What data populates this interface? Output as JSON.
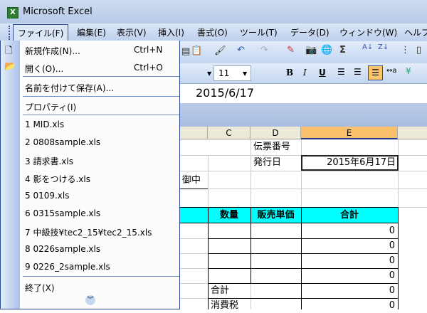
{
  "window": {
    "title": "Microsoft Excel"
  },
  "menubar": [
    "ファイル(F)",
    "編集(E)",
    "表示(V)",
    "挿入(I)",
    "書式(O)",
    "ツール(T)",
    "データ(D)",
    "ウィンドウ(W)",
    "ヘルプ"
  ],
  "file_menu": {
    "new": {
      "label": "新規作成(N)...",
      "shortcut": "Ctrl+N"
    },
    "open": {
      "label": "開く(O)...",
      "shortcut": "Ctrl+O"
    },
    "save_as": {
      "label": "名前を付けて保存(A)..."
    },
    "properties": {
      "label": "プロパティ(I)"
    },
    "recent": [
      "1 MID.xls",
      "2 0808sample.xls",
      "3 請求書.xls",
      "4 影をつける.xls",
      "5 0109.xls",
      "6 0315sample.xls",
      "7 中級技¥tec2_15¥tec2_15.xls",
      "8 0226sample.xls",
      "9 0226_2sample.xls"
    ],
    "exit": {
      "label": "終了(X)"
    }
  },
  "toolbar": {
    "font_size": "11"
  },
  "formula_bar": {
    "value": "2015/6/17"
  },
  "columns": [
    "C",
    "D",
    "E"
  ],
  "selected_column": "E",
  "cells": {
    "d1": "伝票番号",
    "d2": "発行日",
    "e2": "2015年6月17日",
    "b3": "御中",
    "hdr_qty": "数量",
    "hdr_price": "販売単価",
    "hdr_total": "合計",
    "totals": [
      "0",
      "0",
      "0",
      "0"
    ],
    "sum_label": "合計",
    "sum_value": "0",
    "tax_label": "消費税",
    "tax_value": "0"
  },
  "colors": {
    "header_fill": "#00ffff",
    "selected_col": "#f9c06e",
    "menu_border": "#2a4b9a"
  }
}
